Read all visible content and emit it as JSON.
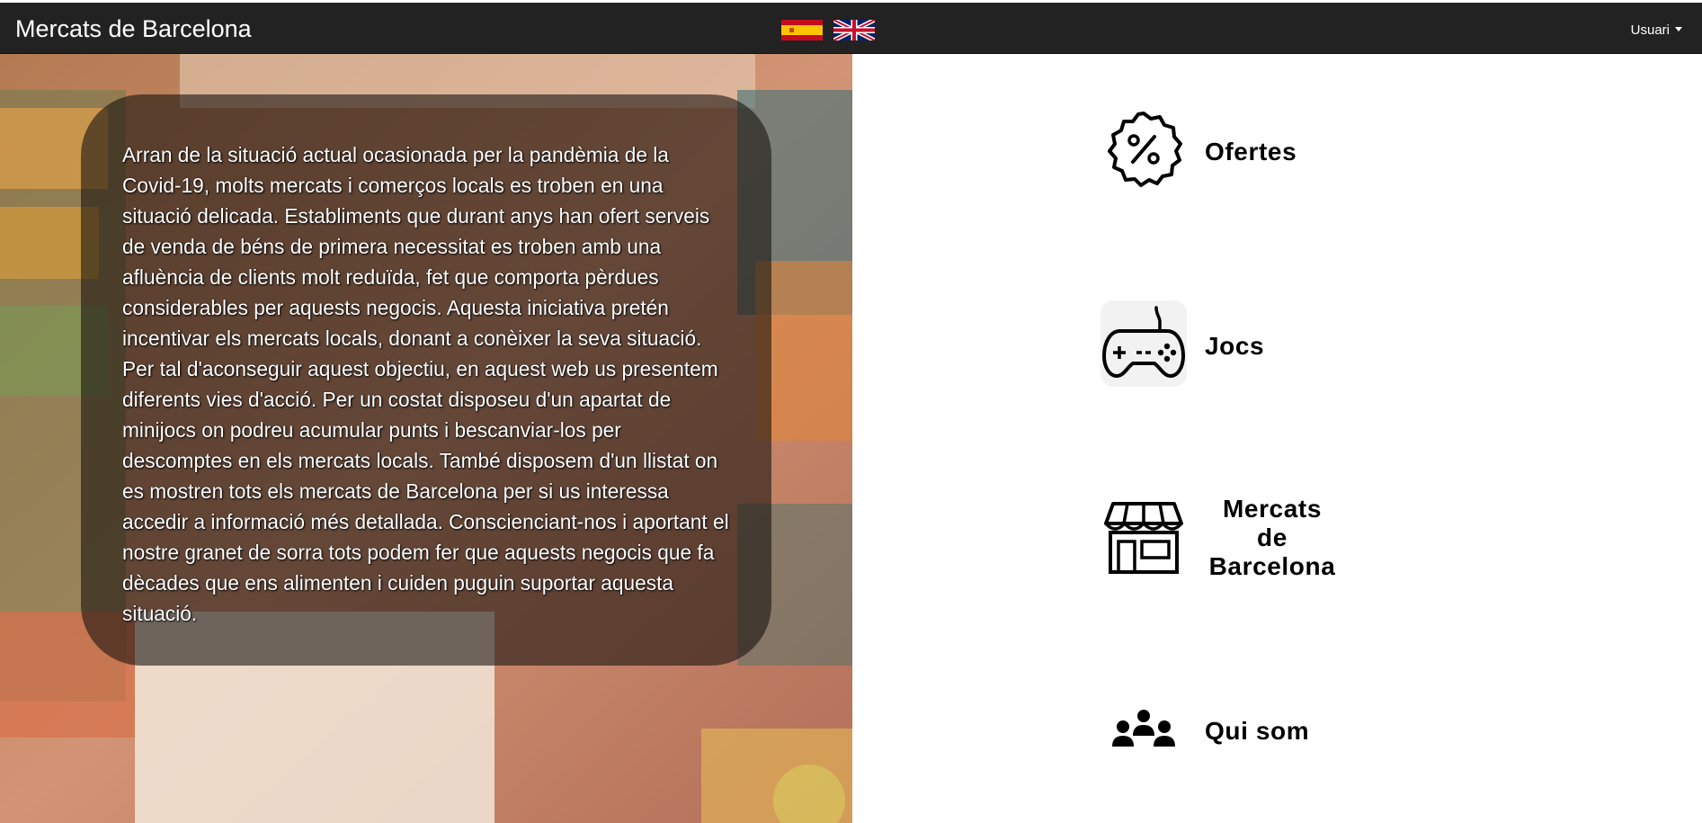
{
  "navbar": {
    "brand": "Mercats de Barcelona",
    "flags": [
      {
        "icon": "spain-flag-icon",
        "language": "es"
      },
      {
        "icon": "uk-flag-icon",
        "language": "en"
      }
    ],
    "user_menu_label": "Usuari"
  },
  "hero": {
    "text": "Arran de la situació actual ocasionada per la pandèmia de la Covid-19, molts mercats i comerços locals es troben en una situació delicada. Establiments que durant anys han ofert serveis de venda de béns de primera necessitat es troben amb una afluència de clients molt reduïda, fet que comporta pèrdues considerables per aquests negocis. Aquesta iniciativa pretén incentivar els mercats locals, donant a conèixer la seva situació. Per tal d'aconseguir aquest objectiu, en aquest web us presentem diferents vies d'acció. Per un costat disposeu d'un apartat de minijocs on podreu acumular punts i bescanviar-los per descomptes en els mercats locals. També disposem d'un llistat on es mostren tots els mercats de Barcelona per si us interessa accedir a informació més detallada. Conscienciant-nos i aportant el nostre granet de sorra tots podem fer que aquests negocis que fa dècades que ens alimenten i cuiden puguin suportar aquesta situació."
  },
  "menu": [
    {
      "label": "Ofertes",
      "icon": "discount-badge-icon"
    },
    {
      "label": "Jocs",
      "icon": "gamepad-icon"
    },
    {
      "label": "Mercats de Barcelona",
      "icon": "market-stall-icon"
    },
    {
      "label": "Qui som",
      "icon": "group-icon"
    }
  ]
}
